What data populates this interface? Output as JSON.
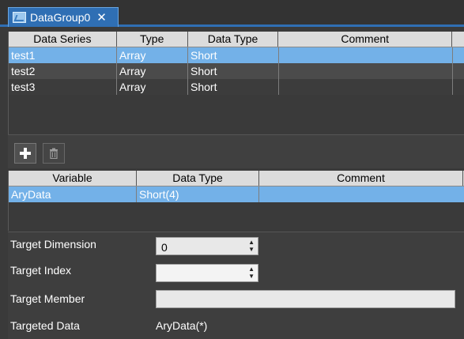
{
  "tab": {
    "title": "DataGroup0",
    "close": "✕"
  },
  "series_table": {
    "headers": [
      "Data Series",
      "Type",
      "Data Type",
      "Comment"
    ],
    "rows": [
      {
        "series": "test1",
        "type": "Array",
        "data_type": "Short",
        "comment": ""
      },
      {
        "series": "test2",
        "type": "Array",
        "data_type": "Short",
        "comment": ""
      },
      {
        "series": "test3",
        "type": "Array",
        "data_type": "Short",
        "comment": ""
      }
    ]
  },
  "toolbar": {
    "add_icon": "+",
    "delete_icon": "🗑"
  },
  "variable_table": {
    "headers": [
      "Variable",
      "Data Type",
      "Comment"
    ],
    "rows": [
      {
        "variable": "AryData",
        "data_type": "Short(4)",
        "comment": ""
      }
    ]
  },
  "properties": {
    "target_dimension": {
      "label": "Target Dimension",
      "value": "0"
    },
    "target_index": {
      "label": "Target Index",
      "value": ""
    },
    "target_member": {
      "label": "Target Member",
      "value": ""
    },
    "targeted_data": {
      "label": "Targeted Data",
      "value": "AryData(*)"
    }
  },
  "colors": {
    "selection": "#73b1e8",
    "tab_accent": "#2f6fb4"
  }
}
